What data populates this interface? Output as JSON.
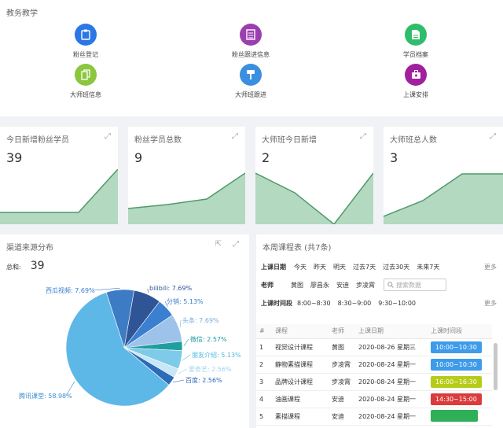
{
  "header": {
    "title": "教务教学"
  },
  "quick_actions": [
    {
      "label": "粉丝登记",
      "icon": "clipboard-icon",
      "color": "#2b77e6"
    },
    {
      "label": "粉丝跟进信息",
      "icon": "list-icon",
      "color": "#9b3fb0"
    },
    {
      "label": "学员档案",
      "icon": "document-icon",
      "color": "#2ebd6b"
    },
    {
      "label": "大师班信息",
      "icon": "copy-icon",
      "color": "#8cc63f"
    },
    {
      "label": "大师班跟进",
      "icon": "brush-icon",
      "color": "#3b8fe0"
    },
    {
      "label": "上课安排",
      "icon": "briefcase-icon",
      "color": "#a0209e"
    }
  ],
  "stats": [
    {
      "title": "今日新增粉丝学员",
      "value": "39"
    },
    {
      "title": "粉丝学员总数",
      "value": "9"
    },
    {
      "title": "大师班今日新增",
      "value": "2"
    },
    {
      "title": "大师班总人数",
      "value": "3"
    }
  ],
  "channel": {
    "title": "渠道来源分布",
    "total_label": "总和:",
    "total_value": "39"
  },
  "chart_data": {
    "type": "pie",
    "title": "渠道来源分布",
    "slices": [
      {
        "label": "bilibili",
        "value": 7.69,
        "text": "bilibili: 7.69%",
        "color": "#2f5596"
      },
      {
        "label": "分销",
        "value": 5.13,
        "text": "分销: 5.13%",
        "color": "#3a7fd0"
      },
      {
        "label": "头条",
        "value": 7.69,
        "text": "头条: 7.69%",
        "color": "#9dc3ea"
      },
      {
        "label": "微信",
        "value": 2.57,
        "text": "微信: 2.57%",
        "color": "#1f9ea0"
      },
      {
        "label": "朋友介绍",
        "value": 5.13,
        "text": "朋友介绍: 5.13%",
        "color": "#7dcbe8"
      },
      {
        "label": "爱奇艺",
        "value": 2.56,
        "text": "爱奇艺: 2.56%",
        "color": "#c9e6f6"
      },
      {
        "label": "百度",
        "value": 2.56,
        "text": "百度: 2.56%",
        "color": "#2c6bb8"
      },
      {
        "label": "腾讯课堂",
        "value": 58.98,
        "text": "腾讯课堂: 58.98%",
        "color": "#5db8e8"
      },
      {
        "label": "西瓜视频",
        "value": 7.69,
        "text": "西瓜视频: 7.69%",
        "color": "#3d7cc4"
      }
    ]
  },
  "schedule": {
    "title": "本周课程表 (共7条)",
    "date_label": "上课日期",
    "date_options": [
      "今天",
      "昨天",
      "明天",
      "过去7天",
      "过去30天",
      "未来7天"
    ],
    "teacher_label": "老师",
    "teacher_options": [
      "黄图",
      "廖昌永",
      "安迪",
      "步凌霄"
    ],
    "search_placeholder": "搜索数据",
    "time_label": "上课时间段",
    "time_options": [
      "8:00~8:30",
      "8:30~9:00",
      "9:30~10:00"
    ],
    "more": "更多",
    "columns": [
      "#",
      "课程",
      "老师",
      "上课日期",
      "上课时间段"
    ],
    "rows": [
      {
        "no": "1",
        "course": "视觉设计课程",
        "teacher": "黄图",
        "date": "2020-08-26 星期三",
        "time": "10:00~10:30",
        "color": "#3d9be9"
      },
      {
        "no": "2",
        "course": "静物素描课程",
        "teacher": "步凌霄",
        "date": "2020-08-24 星期一",
        "time": "10:00~10:30",
        "color": "#3d9be9"
      },
      {
        "no": "3",
        "course": "品牌设计课程",
        "teacher": "步凌霄",
        "date": "2020-08-24 星期一",
        "time": "16:00~16:30",
        "color": "#b5cc18"
      },
      {
        "no": "4",
        "course": "油画课程",
        "teacher": "安迪",
        "date": "2020-08-24 星期一",
        "time": "14:30~15:00",
        "color": "#db3b3b"
      },
      {
        "no": "5",
        "course": "素描课程",
        "teacher": "安迪",
        "date": "2020-08-24 星期一",
        "time": "",
        "color": "#2eaf58"
      }
    ]
  }
}
